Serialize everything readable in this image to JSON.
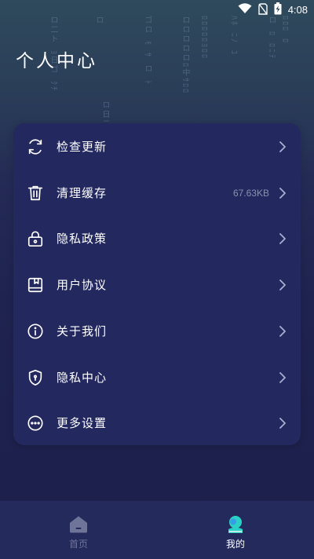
{
  "status_bar": {
    "time": "4:08",
    "icons": [
      "wifi-icon",
      "no-sim-icon",
      "battery-charging-icon"
    ]
  },
  "page": {
    "title": "个人中心"
  },
  "menu": {
    "items": [
      {
        "label": "检查更新",
        "icon": "refresh-icon",
        "value": ""
      },
      {
        "label": "清理缓存",
        "icon": "trash-icon",
        "value": "67.63KB"
      },
      {
        "label": "隐私政策",
        "icon": "lock-icon",
        "value": ""
      },
      {
        "label": "用户协议",
        "icon": "document-icon",
        "value": ""
      },
      {
        "label": "关于我们",
        "icon": "info-icon",
        "value": ""
      },
      {
        "label": "隐私中心",
        "icon": "shield-icon",
        "value": ""
      },
      {
        "label": "更多设置",
        "icon": "more-icon",
        "value": ""
      }
    ]
  },
  "bottom_nav": {
    "items": [
      {
        "label": "首页",
        "icon": "home-icon",
        "active": false
      },
      {
        "label": "我的",
        "icon": "profile-icon",
        "active": true
      }
    ]
  },
  "colors": {
    "background": "#1c1f4a",
    "card": "#23285e",
    "nav_active": "#ffffff",
    "nav_inactive": "#6f7499",
    "accent": "#2bd1c4"
  }
}
